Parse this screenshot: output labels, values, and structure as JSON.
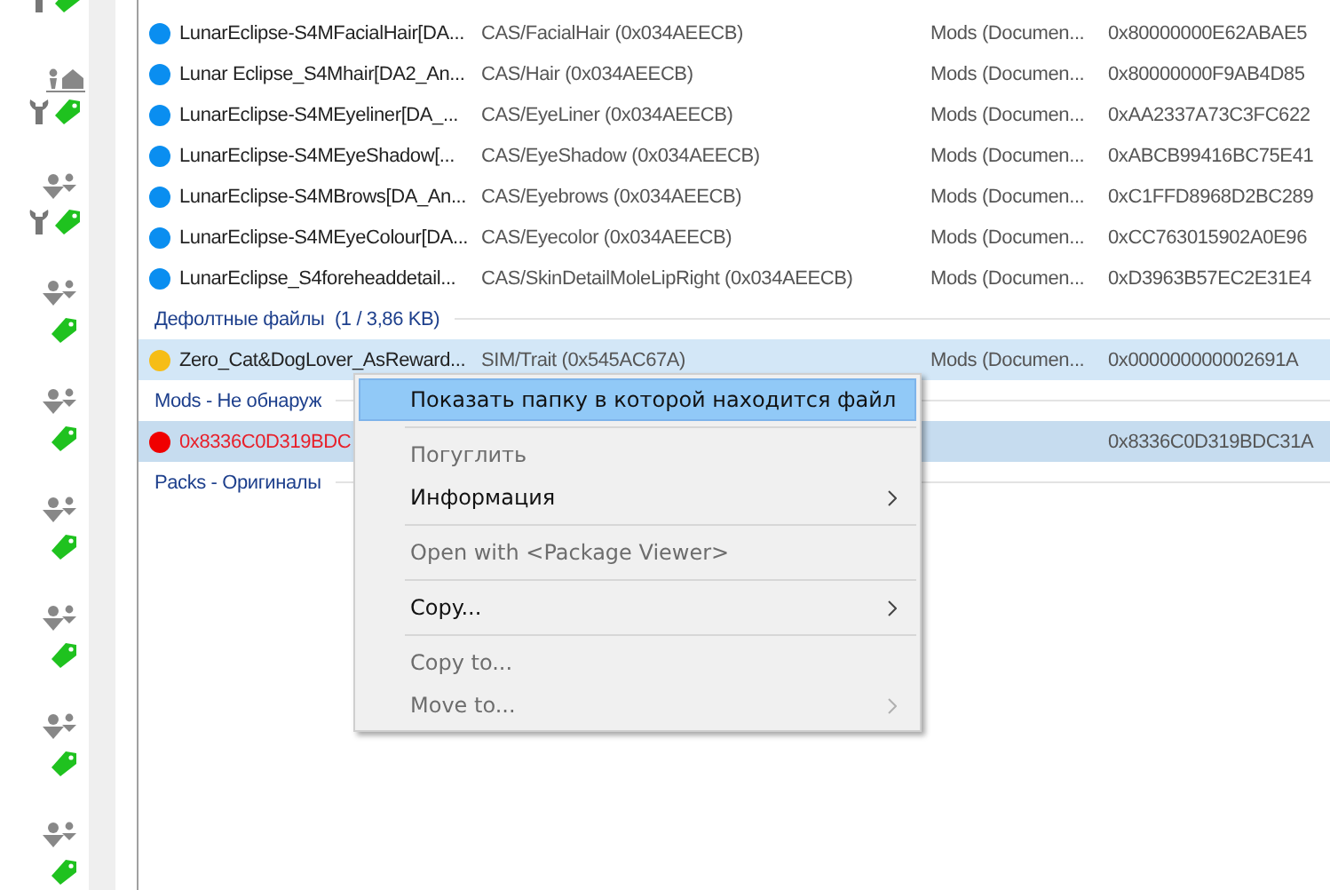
{
  "list": [
    {
      "kind": "file",
      "color": "#0a8ef0",
      "name": "LunarEclipse-S4MFacialHair[DA...",
      "type": "CAS/FacialHair (0x034AEECB)",
      "location": "Mods (Documen...",
      "id": "0x80000000E62ABAE5",
      "selected": false,
      "error": false
    },
    {
      "kind": "file",
      "color": "#0a8ef0",
      "name": "Lunar Eclipse_S4Mhair[DA2_An...",
      "type": "CAS/Hair (0x034AEECB)",
      "location": "Mods (Documen...",
      "id": "0x80000000F9AB4D85",
      "selected": false,
      "error": false
    },
    {
      "kind": "file",
      "color": "#0a8ef0",
      "name": "LunarEclipse-S4MEyeliner[DA_...",
      "type": "CAS/EyeLiner (0x034AEECB)",
      "location": "Mods (Documen...",
      "id": "0xAA2337A73C3FC622",
      "selected": false,
      "error": false
    },
    {
      "kind": "file",
      "color": "#0a8ef0",
      "name": "LunarEclipse-S4MEyeShadow[...",
      "type": "CAS/EyeShadow (0x034AEECB)",
      "location": "Mods (Documen...",
      "id": "0xABCB99416BC75E41",
      "selected": false,
      "error": false
    },
    {
      "kind": "file",
      "color": "#0a8ef0",
      "name": "LunarEclipse-S4MBrows[DA_An...",
      "type": "CAS/Eyebrows (0x034AEECB)",
      "location": "Mods (Documen...",
      "id": "0xC1FFD8968D2BC289",
      "selected": false,
      "error": false
    },
    {
      "kind": "file",
      "color": "#0a8ef0",
      "name": "LunarEclipse-S4MEyeColour[DA...",
      "type": "CAS/Eyecolor (0x034AEECB)",
      "location": "Mods (Documen...",
      "id": "0xCC763015902A0E96",
      "selected": false,
      "error": false
    },
    {
      "kind": "file",
      "color": "#0a8ef0",
      "name": "LunarEclipse_S4foreheaddetail...",
      "type": "CAS/SkinDetailMoleLipRight (0x034AEECB)",
      "location": "Mods (Documen...",
      "id": "0xD3963B57EC2E31E4",
      "selected": false,
      "error": false
    },
    {
      "kind": "group",
      "label": "Дефолтные файлы  (1 / 3,86 KB)"
    },
    {
      "kind": "file",
      "color": "#f6bd16",
      "name": "Zero_Cat&DogLover_AsReward...",
      "type": "SIM/Trait (0x545AC67A)",
      "location": "Mods (Documen...",
      "id": "0x000000000002691A",
      "selected": true,
      "error": false
    },
    {
      "kind": "group",
      "label": "Mods - Не обнаруж"
    },
    {
      "kind": "file",
      "color": "#f00000",
      "name": "0x8336C0D319BDC",
      "id": "0x8336C0D319BDC31A",
      "selected": true,
      "error": true
    },
    {
      "kind": "group",
      "label": "Packs - Оригиналы"
    }
  ],
  "context_menu": [
    {
      "kind": "item",
      "label": "Показать папку в которой находится файл",
      "selected": true,
      "disabled": false,
      "submenu": false
    },
    {
      "kind": "separator"
    },
    {
      "kind": "item",
      "label": "Погуглить",
      "selected": false,
      "disabled": true,
      "submenu": false
    },
    {
      "kind": "item",
      "label": "Информация",
      "selected": false,
      "disabled": false,
      "submenu": true
    },
    {
      "kind": "separator"
    },
    {
      "kind": "item",
      "label": "Open with <Package Viewer>",
      "selected": false,
      "disabled": true,
      "submenu": false
    },
    {
      "kind": "separator"
    },
    {
      "kind": "item",
      "label": "Copy...",
      "selected": false,
      "disabled": false,
      "submenu": true
    },
    {
      "kind": "separator"
    },
    {
      "kind": "item",
      "label": "Copy to...",
      "selected": false,
      "disabled": true,
      "submenu": false
    },
    {
      "kind": "item",
      "label": "Move to...",
      "selected": false,
      "disabled": true,
      "submenu": true
    }
  ]
}
